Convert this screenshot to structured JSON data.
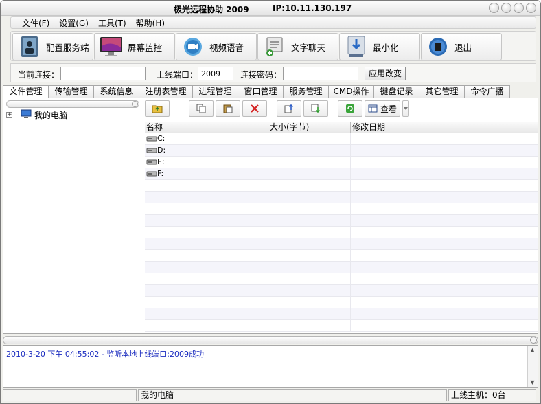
{
  "window": {
    "title": "极光远程协助 2009",
    "ip": "IP:10.11.130.197"
  },
  "menu": [
    "文件(F)",
    "设置(G)",
    "工具(T)",
    "帮助(H)"
  ],
  "toolbar": [
    {
      "label": "配置服务端",
      "icon": "config-server-icon"
    },
    {
      "label": "屏幕监控",
      "icon": "monitor-icon"
    },
    {
      "label": "视频语音",
      "icon": "camera-icon"
    },
    {
      "label": "文字聊天",
      "icon": "chat-icon"
    },
    {
      "label": "最小化",
      "icon": "minimize-icon"
    },
    {
      "label": "退出",
      "icon": "exit-icon"
    }
  ],
  "connection": {
    "current_label": "当前连接：",
    "current_value": "",
    "port_label": "上线端口：",
    "port_value": "2009",
    "password_label": "连接密码：",
    "password_value": "",
    "apply_label": "应用改变"
  },
  "tabs": [
    "文件管理",
    "传输管理",
    "系统信息",
    "注册表管理",
    "进程管理",
    "窗口管理",
    "服务管理",
    "CMD操作",
    "键盘记录",
    "其它管理",
    "命令广播"
  ],
  "tree": {
    "root_label": "我的电脑",
    "expand_symbol": "+"
  },
  "file_toolbar": {
    "view_label": "查看"
  },
  "grid": {
    "columns": [
      "名称",
      "大小(字节)",
      "修改日期",
      ""
    ],
    "rows": [
      {
        "name": "C:",
        "size": "",
        "date": ""
      },
      {
        "name": "D:",
        "size": "",
        "date": ""
      },
      {
        "name": "E:",
        "size": "",
        "date": ""
      },
      {
        "name": "F:",
        "size": "",
        "date": ""
      }
    ]
  },
  "log": {
    "lines": [
      "2010-3-20 下午 04:55:02 - 监听本地上线端口:2009成功"
    ]
  },
  "status": {
    "left": "",
    "middle": "我的电脑",
    "right": "上线主机：0台"
  },
  "colors": {
    "log_text": "#1a2bbf",
    "delete_red": "#d42020"
  }
}
